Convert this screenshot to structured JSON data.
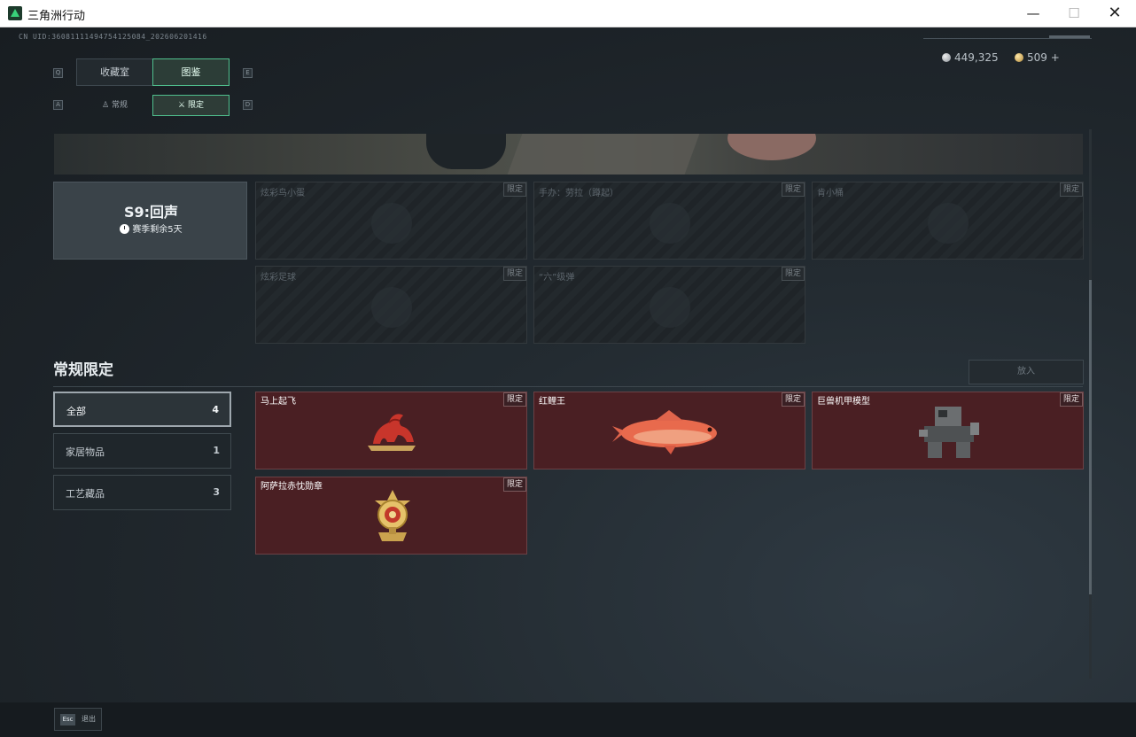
{
  "window": {
    "title": "三角洲行动",
    "minimize": "—",
    "maximize": "☐",
    "close": "✕"
  },
  "header": {
    "uid": "CN UID:36081111494754125084_202606201416",
    "currency": [
      {
        "icon": "silver-coin-icon",
        "value": "449,325"
      },
      {
        "icon": "gold-coin-icon",
        "value": "509 +"
      }
    ]
  },
  "tabs": {
    "key_left": "Q",
    "key_right": "E",
    "items": [
      {
        "label": "收藏室",
        "active": false
      },
      {
        "label": "图鉴",
        "active": true
      }
    ]
  },
  "subtabs": {
    "key_left": "A",
    "key_right": "D",
    "items": [
      {
        "label": "常规",
        "icon": "figure-icon",
        "active": false
      },
      {
        "label": "限定",
        "icon": "crossed-swords-icon",
        "active": true
      }
    ]
  },
  "season": {
    "title": "S9:回声",
    "subtitle": "赛季剩余5天"
  },
  "limited_tag": "限定",
  "season_items": [
    {
      "name": "炫彩鸟小蛋"
    },
    {
      "name": "手办：劳拉（蹲起）"
    },
    {
      "name": "肯小桶"
    },
    {
      "name": "炫彩足球"
    },
    {
      "name": "“六”级弹"
    }
  ],
  "section": {
    "title": "常规限定",
    "put_in_button": "放入"
  },
  "filters": [
    {
      "label": "全部",
      "count": "4",
      "active": true
    },
    {
      "label": "家居物品",
      "count": "1",
      "active": false
    },
    {
      "label": "工艺藏品",
      "count": "3",
      "active": false
    }
  ],
  "collection_items": [
    {
      "name": "马上起飞",
      "icon": "red-horse-icon"
    },
    {
      "name": "红鲤王",
      "icon": "red-carp-icon"
    },
    {
      "name": "巨兽机甲模型",
      "icon": "mech-model-icon"
    },
    {
      "name": "阿萨拉赤忱勋章",
      "icon": "gold-medal-icon"
    }
  ],
  "footer": {
    "esc_key": "Esc",
    "esc_label": "退出"
  },
  "colors": {
    "accent": "#4fbf8d",
    "card_bg": "#4a1f23",
    "locked_bg": "#1f2428"
  }
}
